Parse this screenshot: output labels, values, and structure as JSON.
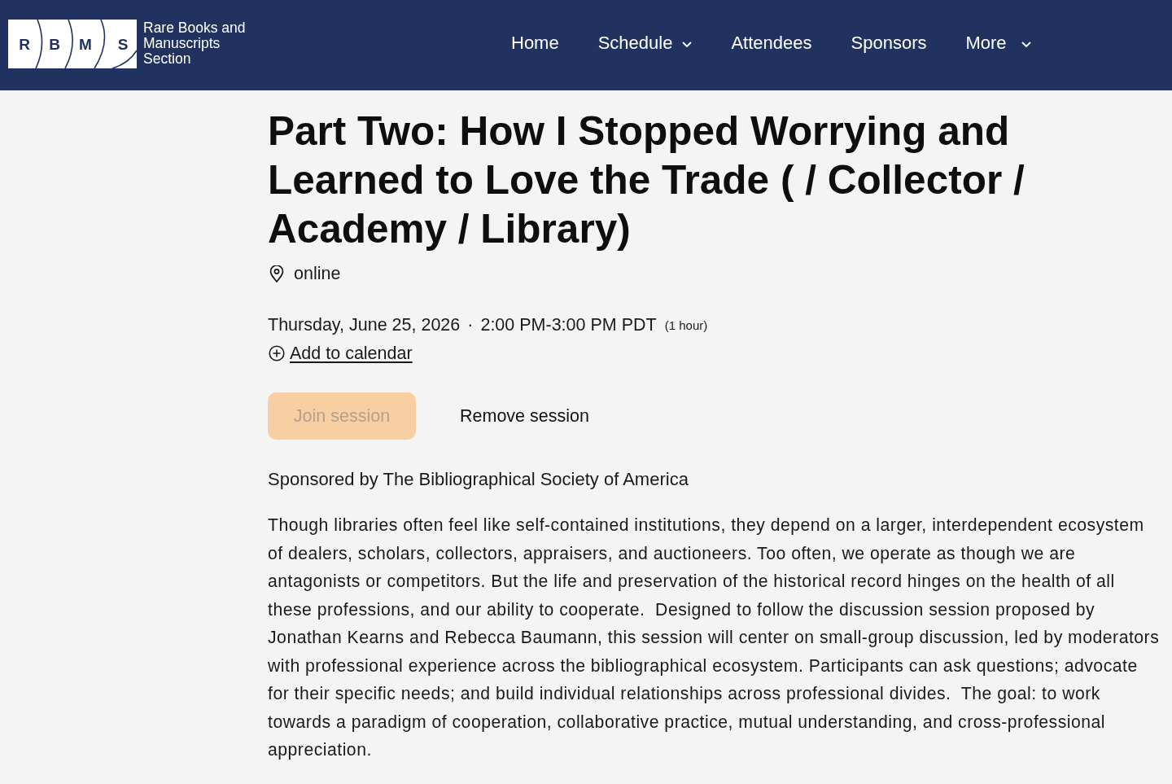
{
  "header": {
    "logo": {
      "letters": [
        "R",
        "B",
        "M",
        "S"
      ],
      "text": "Rare Books and Manuscripts Section"
    },
    "nav": [
      {
        "label": "Home",
        "dropdown": false
      },
      {
        "label": "Schedule",
        "dropdown": true
      },
      {
        "label": "Attendees",
        "dropdown": false
      },
      {
        "label": "Sponsors",
        "dropdown": false
      },
      {
        "label": "More",
        "dropdown": true
      }
    ]
  },
  "session": {
    "title": "Part Two: How I Stopped Worrying and Learned to Love the Trade ( / Collector / Academy / Library)",
    "location": "online",
    "date": "Thursday, June 25, 2026",
    "separator": "·",
    "time": "2:00 PM-3:00 PM PDT",
    "duration": "(1 hour)",
    "calendar_link": "Add to calendar",
    "buttons": [
      {
        "label": "Join session",
        "kind": "primary",
        "disabled": true
      },
      {
        "label": "Remove session",
        "kind": "plain",
        "disabled": false
      }
    ],
    "sponsor": "Sponsored by The Bibliographical Society of America",
    "description": "Though libraries often feel like self-contained institutions, they depend on a larger, interdependent ecosystem of dealers, scholars, collectors, appraisers, and auctioneers. Too often, we operate as though we are antagonists or competitors. But the life and preservation of the historical record hinges on the health of all these professions, and our ability to cooperate.  Designed to follow the discussion session proposed by Jonathan Kearns and Rebecca Baumann, this session will center on small-group discussion, led by moderators with professional experience across the bibliographical ecosystem. Participants can ask questions; advocate for their specific needs; and build individual relationships across professional divides.  The goal: to work towards a paradigm of cooperation, collaborative practice, mutual understanding, and cross-professional appreciation."
  }
}
